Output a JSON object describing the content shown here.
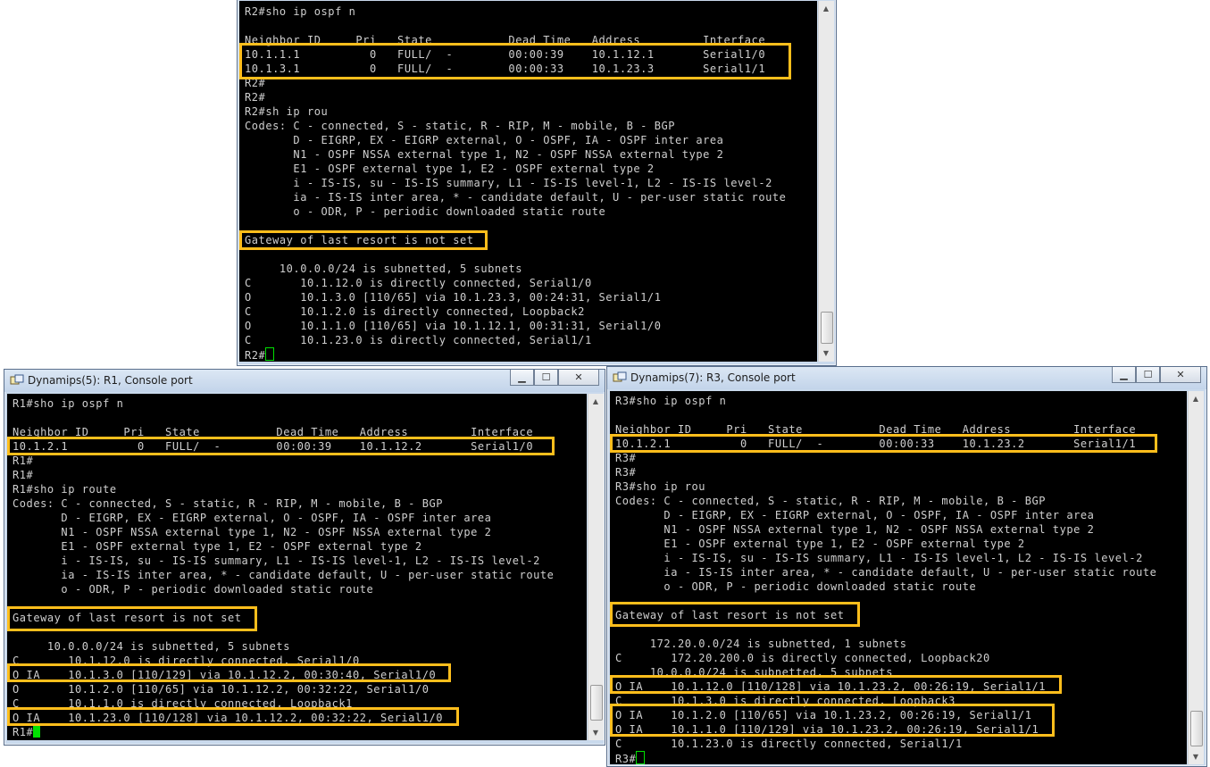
{
  "colors": {
    "highlight": "#ffbe1c",
    "terminal_bg": "#000000",
    "terminal_fg": "#cfcfcf",
    "cursor": "#00e000"
  },
  "r2": {
    "lines": [
      "R2#sho ip ospf n",
      "",
      "Neighbor ID     Pri   State           Dead Time   Address         Interface",
      "10.1.1.1          0   FULL/  -        00:00:39    10.1.12.1       Serial1/0",
      "10.1.3.1          0   FULL/  -        00:00:33    10.1.23.3       Serial1/1",
      "R2#",
      "R2#",
      "R2#sh ip rou",
      "Codes: C - connected, S - static, R - RIP, M - mobile, B - BGP",
      "       D - EIGRP, EX - EIGRP external, O - OSPF, IA - OSPF inter area",
      "       N1 - OSPF NSSA external type 1, N2 - OSPF NSSA external type 2",
      "       E1 - OSPF external type 1, E2 - OSPF external type 2",
      "       i - IS-IS, su - IS-IS summary, L1 - IS-IS level-1, L2 - IS-IS level-2",
      "       ia - IS-IS inter area, * - candidate default, U - per-user static route",
      "       o - ODR, P - periodic downloaded static route",
      "",
      "Gateway of last resort is not set",
      "",
      "     10.0.0.0/24 is subnetted, 5 subnets",
      "C       10.1.12.0 is directly connected, Serial1/0",
      "O       10.1.3.0 [110/65] via 10.1.23.3, 00:24:31, Serial1/1",
      "C       10.1.2.0 is directly connected, Loopback2",
      "O       10.1.1.0 [110/65] via 10.1.12.1, 00:31:31, Serial1/0",
      "C       10.1.23.0 is directly connected, Serial1/1",
      "R2#"
    ]
  },
  "r1": {
    "title": "Dynamips(5): R1, Console port",
    "lines": [
      "R1#sho ip ospf n",
      "",
      "Neighbor ID     Pri   State           Dead Time   Address         Interface",
      "10.1.2.1          0   FULL/  -        00:00:39    10.1.12.2       Serial1/0",
      "R1#",
      "R1#",
      "R1#sho ip route",
      "Codes: C - connected, S - static, R - RIP, M - mobile, B - BGP",
      "       D - EIGRP, EX - EIGRP external, O - OSPF, IA - OSPF inter area",
      "       N1 - OSPF NSSA external type 1, N2 - OSPF NSSA external type 2",
      "       E1 - OSPF external type 1, E2 - OSPF external type 2",
      "       i - IS-IS, su - IS-IS summary, L1 - IS-IS level-1, L2 - IS-IS level-2",
      "       ia - IS-IS inter area, * - candidate default, U - per-user static route",
      "       o - ODR, P - periodic downloaded static route",
      "",
      "Gateway of last resort is not set",
      "",
      "     10.0.0.0/24 is subnetted, 5 subnets",
      "C       10.1.12.0 is directly connected, Serial1/0",
      "O IA    10.1.3.0 [110/129] via 10.1.12.2, 00:30:40, Serial1/0",
      "O       10.1.2.0 [110/65] via 10.1.12.2, 00:32:22, Serial1/0",
      "C       10.1.1.0 is directly connected, Loopback1",
      "O IA    10.1.23.0 [110/128] via 10.1.12.2, 00:32:22, Serial1/0",
      "R1#"
    ]
  },
  "r3": {
    "title": "Dynamips(7): R3, Console port",
    "lines": [
      "R3#sho ip ospf n",
      "",
      "Neighbor ID     Pri   State           Dead Time   Address         Interface",
      "10.1.2.1          0   FULL/  -        00:00:33    10.1.23.2       Serial1/1",
      "R3#",
      "R3#",
      "R3#sho ip rou",
      "Codes: C - connected, S - static, R - RIP, M - mobile, B - BGP",
      "       D - EIGRP, EX - EIGRP external, O - OSPF, IA - OSPF inter area",
      "       N1 - OSPF NSSA external type 1, N2 - OSPF NSSA external type 2",
      "       E1 - OSPF external type 1, E2 - OSPF external type 2",
      "       i - IS-IS, su - IS-IS summary, L1 - IS-IS level-1, L2 - IS-IS level-2",
      "       ia - IS-IS inter area, * - candidate default, U - per-user static route",
      "       o - ODR, P - periodic downloaded static route",
      "",
      "Gateway of last resort is not set",
      "",
      "     172.20.0.0/24 is subnetted, 1 subnets",
      "C       172.20.200.0 is directly connected, Loopback20",
      "     10.0.0.0/24 is subnetted, 5 subnets",
      "O IA    10.1.12.0 [110/128] via 10.1.23.2, 00:26:19, Serial1/1",
      "C       10.1.3.0 is directly connected, Loopback3",
      "O IA    10.1.2.0 [110/65] via 10.1.23.2, 00:26:19, Serial1/1",
      "O IA    10.1.1.0 [110/129] via 10.1.23.2, 00:26:19, Serial1/1",
      "C       10.1.23.0 is directly connected, Serial1/1",
      "R3#"
    ]
  }
}
